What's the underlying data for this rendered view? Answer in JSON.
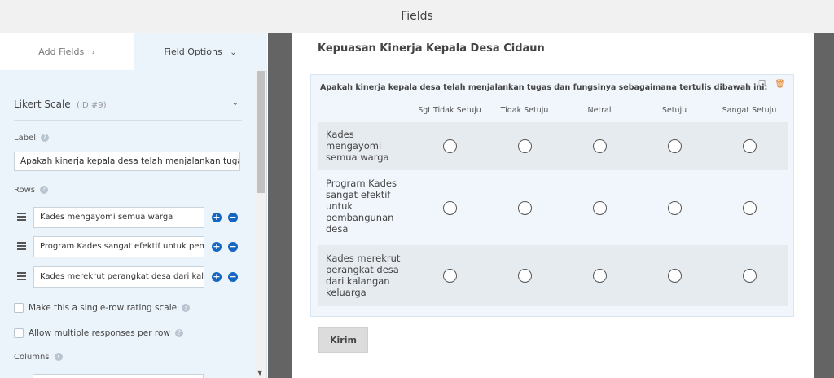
{
  "header": {
    "title": "Fields"
  },
  "sidebar": {
    "tabs": [
      {
        "label": "Add Fields",
        "chevron": "chevron-right-icon"
      },
      {
        "label": "Field Options",
        "chevron": "chevron-down-icon"
      }
    ],
    "field": {
      "name": "Likert Scale",
      "id": "(ID #9)"
    },
    "label_section": {
      "title": "Label",
      "value": "Apakah kinerja kepala desa telah menjalankan tugas dan fungsinya sebagaimana tertulis dibawah ini:"
    },
    "rows_section": {
      "title": "Rows",
      "items": [
        "Kades mengayomi semua warga",
        "Program Kades sangat efektif untuk pembangunan desa",
        "Kades merekrut perangkat desa dari kalangan keluarga"
      ]
    },
    "options": [
      "Make this a single-row rating scale",
      "Allow multiple responses per row"
    ],
    "columns_section": {
      "title": "Columns"
    }
  },
  "preview": {
    "form_title": "Kepuasan Kinerja Kepala Desa Cidaun",
    "question": "Apakah kinerja kepala desa telah menjalankan tugas dan fungsinya sebagaimana tertulis dibawah ini:",
    "columns": [
      "Sgt Tidak Setuju",
      "Tidak Setuju",
      "Netral",
      "Setuju",
      "Sangat Setuju"
    ],
    "rows": [
      "Kades mengayomi semua warga",
      "Program Kades sangat efektif untuk pembangunan desa",
      "Kades merekrut perangkat desa dari kalangan keluarga"
    ],
    "submit_label": "Kirim"
  },
  "colors": {
    "accent": "#1566c0",
    "sidebar_bg": "#ebf3fb",
    "canvas_bg": "#646464",
    "trash": "#e67e22"
  }
}
